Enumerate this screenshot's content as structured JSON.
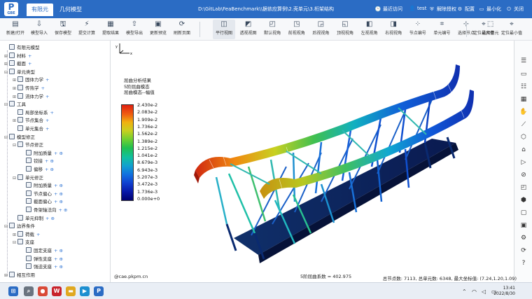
{
  "titlebar": {
    "app_short": "P",
    "app_sub": "GBE",
    "tabs": [
      {
        "label": "有限元"
      },
      {
        "label": "几何模型"
      }
    ],
    "doc_path": "D:\\GitLab\\FeaBenchmark\\\\据依应算例\\2.壳单元\\3.桁架结构",
    "actions": [
      {
        "icon": "clock-icon",
        "glyph": "🕒",
        "label": "最近访问"
      },
      {
        "icon": "user-icon",
        "glyph": "👤",
        "label": "test"
      },
      {
        "icon": "shield-icon",
        "glyph": "⛨",
        "label": "解除授权"
      },
      {
        "icon": "gear-icon",
        "glyph": "⚙",
        "label": "配置"
      },
      {
        "icon": "minimize-icon",
        "glyph": "▭",
        "label": "最小化"
      },
      {
        "icon": "power-icon",
        "glyph": "⏻",
        "label": "关闭"
      }
    ]
  },
  "toolbar": {
    "left": [
      {
        "label": "新建/打开",
        "glyph": "▤",
        "icon": "open-file-icon"
      },
      {
        "label": "模型导入",
        "glyph": "⇩",
        "icon": "import-icon"
      },
      {
        "label": "保存模型",
        "glyph": "🖫",
        "icon": "save-icon"
      },
      {
        "label": "提交计算",
        "glyph": "⚡",
        "icon": "lightning-icon"
      },
      {
        "label": "提取结果",
        "glyph": "▦",
        "icon": "extract-results-icon"
      },
      {
        "label": "模型导出",
        "glyph": "⇧",
        "icon": "export-icon"
      },
      {
        "label": "更新预览",
        "glyph": "▣",
        "icon": "preview-icon"
      },
      {
        "label": "刷新页面",
        "glyph": "⟳",
        "icon": "refresh-icon"
      }
    ],
    "views": [
      {
        "label": "平行视图",
        "glyph": "◫",
        "icon": "parallel-view-icon"
      },
      {
        "label": "透视视图",
        "glyph": "◩",
        "icon": "perspective-view-icon"
      },
      {
        "label": "默认视角",
        "glyph": "◰",
        "icon": "default-view-icon"
      },
      {
        "label": "前视视角",
        "glyph": "◳",
        "icon": "front-view-icon"
      },
      {
        "label": "后视视角",
        "glyph": "◲",
        "icon": "back-view-icon"
      },
      {
        "label": "顶视视角",
        "glyph": "◱",
        "icon": "top-view-icon"
      },
      {
        "label": "左视视角",
        "glyph": "◧",
        "icon": "left-view-icon"
      },
      {
        "label": "右视视角",
        "glyph": "◨",
        "icon": "right-view-icon"
      },
      {
        "label": "节点编号",
        "glyph": "⁘",
        "icon": "node-number-icon"
      },
      {
        "label": "单元编号",
        "glyph": "⌗",
        "icon": "element-number-icon"
      },
      {
        "label": "选择节点",
        "glyph": "⊹",
        "icon": "select-node-icon"
      },
      {
        "label": "选择单元",
        "glyph": "⬚",
        "icon": "select-element-icon"
      }
    ],
    "locate": [
      {
        "label": "定位最大值",
        "glyph": "⌖",
        "icon": "locate-max-icon"
      },
      {
        "label": "定位最小值",
        "glyph": "⌖",
        "icon": "locate-min-icon"
      }
    ]
  },
  "tree": [
    {
      "label": "有限元模型",
      "level": 0,
      "ex": "",
      "add": ""
    },
    {
      "label": "材料",
      "level": 0,
      "ex": "⊞",
      "add": "+"
    },
    {
      "label": "截面",
      "level": 0,
      "ex": "⊞",
      "add": "+"
    },
    {
      "label": "单元类型",
      "level": 0,
      "ex": "⊟",
      "add": ""
    },
    {
      "label": "固体力学",
      "level": 1,
      "ex": "⊞",
      "add": "+"
    },
    {
      "label": "传热学",
      "level": 1,
      "ex": "⊞",
      "add": "+"
    },
    {
      "label": "流体力学",
      "level": 1,
      "ex": "⊞",
      "add": "+"
    },
    {
      "label": "工具",
      "level": 0,
      "ex": "⊟",
      "add": ""
    },
    {
      "label": "局部坐标系",
      "level": 1,
      "ex": "",
      "add": "+"
    },
    {
      "label": "节点集合",
      "level": 1,
      "ex": "⊞",
      "add": "+"
    },
    {
      "label": "单元集合",
      "level": 1,
      "ex": "",
      "add": "+"
    },
    {
      "label": "模型修正",
      "level": 0,
      "ex": "⊟",
      "add": ""
    },
    {
      "label": "节点修正",
      "level": 1,
      "ex": "⊟",
      "add": ""
    },
    {
      "label": "附加质量",
      "level": 2,
      "ex": "",
      "add": "+ ⊕"
    },
    {
      "label": "铰接",
      "level": 2,
      "ex": "",
      "add": "+ ⊕"
    },
    {
      "label": "偏移",
      "level": 2,
      "ex": "",
      "add": "+ ⊕"
    },
    {
      "label": "单元修正",
      "level": 1,
      "ex": "⊟",
      "add": ""
    },
    {
      "label": "附加质量",
      "level": 2,
      "ex": "",
      "add": "+ ⊕"
    },
    {
      "label": "节点偏心",
      "level": 2,
      "ex": "",
      "add": "+ ⊕"
    },
    {
      "label": "截面偏心",
      "level": 2,
      "ex": "",
      "add": "+ ⊕"
    },
    {
      "label": "骨架轴法向",
      "level": 2,
      "ex": "",
      "add": "+ ⊕"
    },
    {
      "label": "单元抑制",
      "level": 1,
      "ex": "",
      "add": "+ ⊕"
    },
    {
      "label": "边界条件",
      "level": 0,
      "ex": "⊟",
      "add": ""
    },
    {
      "label": "荷载",
      "level": 1,
      "ex": "⊞",
      "add": "+"
    },
    {
      "label": "支座",
      "level": 1,
      "ex": "⊟",
      "add": ""
    },
    {
      "label": "固定支座",
      "level": 2,
      "ex": "",
      "add": "+ ⊕"
    },
    {
      "label": "弹性支座",
      "level": 2,
      "ex": "",
      "add": "+ ⊕"
    },
    {
      "label": "强迫支座",
      "level": 2,
      "ex": "",
      "add": "+ ⊕"
    },
    {
      "label": "相互作用",
      "level": 0,
      "ex": "⊞",
      "add": ""
    }
  ],
  "viewport": {
    "result_title": [
      "屈曲分析结果",
      "5阶屈曲模态",
      "屈曲模态--幅值"
    ],
    "legend_values": [
      "2.430e-2",
      "2.083e-2",
      "1.909e-2",
      "1.736e-2",
      "1.562e-2",
      "1.389e-2",
      "1.215e-2",
      "1.041e-2",
      "8.679e-3",
      "6.943e-3",
      "5.207e-3",
      "3.472e-3",
      "1.736e-3",
      "0.000e+0"
    ],
    "domain": "@cae.pkpm.cn",
    "frequency": "5阶屈曲系数 = 402.975"
  },
  "status": {
    "stats": "总节点数: 7113, 总单元数: 6348, 最大坐标值: (7.24,1.20,1.09)"
  },
  "taskbar": {
    "time": "13:41",
    "date": "2022/8/30",
    "apps": [
      {
        "icon": "windows-start-icon",
        "glyph": "⊞",
        "color": "#2b6cc4"
      },
      {
        "icon": "search-icon",
        "glyph": "⌕",
        "color": "#6a7480"
      },
      {
        "icon": "chrome-icon",
        "glyph": "●",
        "color": "#d94a38"
      },
      {
        "icon": "wps-icon",
        "glyph": "W",
        "color": "#c8232c"
      },
      {
        "icon": "explorer-icon",
        "glyph": "▬",
        "color": "#e0a820"
      },
      {
        "icon": "player-icon",
        "glyph": "▶",
        "color": "#1d8fd0"
      },
      {
        "icon": "pkpm-icon",
        "glyph": "P",
        "color": "#2b6cc4"
      }
    ]
  }
}
